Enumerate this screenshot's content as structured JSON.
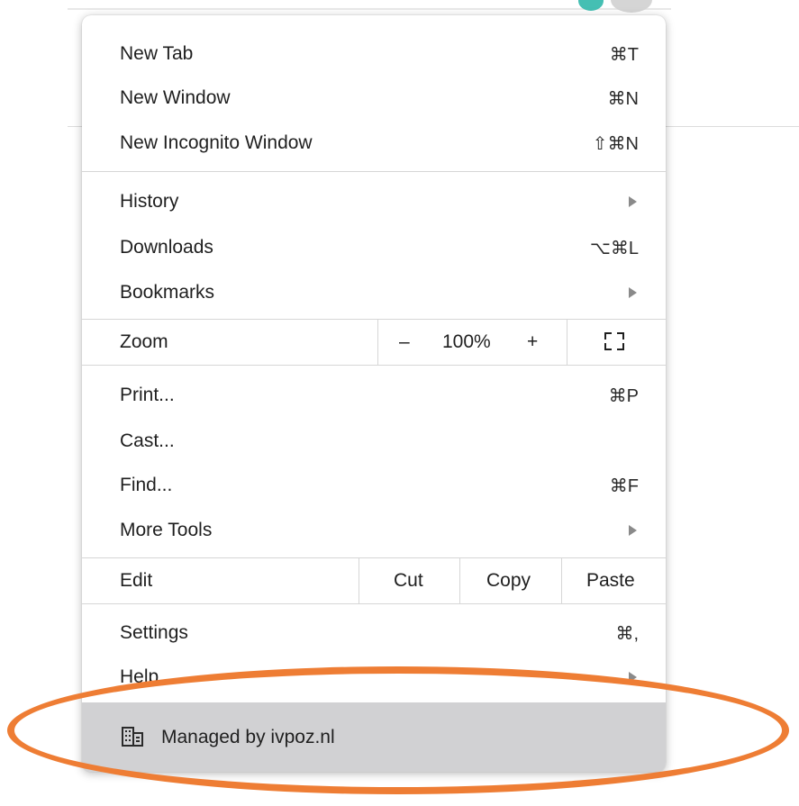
{
  "menu": {
    "new_tab": {
      "label": "New Tab",
      "shortcut": "⌘T"
    },
    "new_window": {
      "label": "New Window",
      "shortcut": "⌘N"
    },
    "new_incognito": {
      "label": "New Incognito Window",
      "shortcut": "⇧⌘N"
    },
    "history": {
      "label": "History"
    },
    "downloads": {
      "label": "Downloads",
      "shortcut": "⌥⌘L"
    },
    "bookmarks": {
      "label": "Bookmarks"
    },
    "zoom": {
      "label": "Zoom",
      "minus": "–",
      "value": "100%",
      "plus": "+"
    },
    "print": {
      "label": "Print...",
      "shortcut": "⌘P"
    },
    "cast": {
      "label": "Cast..."
    },
    "find": {
      "label": "Find...",
      "shortcut": "⌘F"
    },
    "more_tools": {
      "label": "More Tools"
    },
    "edit": {
      "label": "Edit",
      "cut": "Cut",
      "copy": "Copy",
      "paste": "Paste"
    },
    "settings": {
      "label": "Settings",
      "shortcut": "⌘,"
    },
    "help": {
      "label": "Help"
    },
    "managed": {
      "label": "Managed by ivpoz.nl",
      "icon": "building-icon"
    }
  },
  "annotation": {
    "color": "#ee7d34"
  }
}
